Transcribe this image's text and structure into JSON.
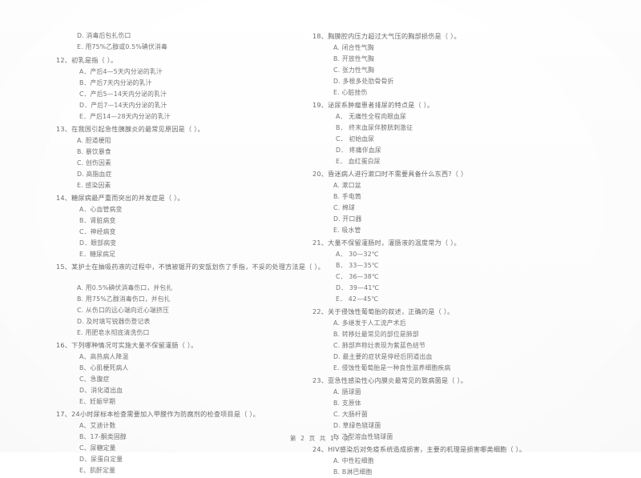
{
  "document": {
    "type": "exam-paper",
    "language": "zh-CN",
    "footer": "第 2 页  共 17 页"
  },
  "columns": {
    "left": {
      "orphan_options": [
        "D. 消毒后包扎伤口",
        "E. 用75%乙醇或0.5%碘伏消毒"
      ],
      "questions": [
        {
          "number": "12、",
          "stem": "初乳是指（     ）。",
          "options": [
            "A．产后4—5天内分泌的乳汁",
            "B．产后7天内分泌的乳汁",
            "C．产后5—14天内分泌的乳汁",
            "D．产后7—14天内分泌的乳汁",
            "E．产后14—28天内分泌的乳汁"
          ]
        },
        {
          "number": "13、",
          "stem": "在我国引起急性胰腺炎的最常见原因是（     ）。",
          "options": [
            "A. 胆道梗阻",
            "B. 暴饮暴食",
            "C. 创伤因素",
            "D. 高脂血症",
            "E. 感染因素"
          ]
        },
        {
          "number": "14、",
          "stem": "糖尿病最严重而突出的并发症是（     ）。",
          "options": [
            "A．心血管病变",
            "B．肾脏病变",
            "C．神经病变",
            "D．眼部病变",
            "E．糖尿病足"
          ]
        },
        {
          "number": "15、",
          "stem": "某护士在抽吸药液的过程中，不慎被锯开的安瓿划伤了手指，不妥的处理方法是（         ）。",
          "options": [
            "A. 用0.5%碘伏消毒伤口，并包扎",
            "B. 用75%乙醇消毒伤口，并包扎",
            "C. 从伤口的远心端向近心端挤压",
            "D. 及时填写锐器伤登记表",
            "E. 用肥皂水彻底清洗伤口"
          ]
        },
        {
          "number": "16、",
          "stem": "下列哪种情况可实施大量不保留灌肠（     ）。",
          "options": [
            "A、高热病人降温",
            "B、心肌梗死病人",
            "C、急腹症",
            "D、消化道出血",
            "E、妊娠早期"
          ]
        },
        {
          "number": "17、",
          "stem": "24小时尿标本检查需要加入甲醛作为防腐剂的检查项目是（     ）。",
          "options": [
            "A、艾迪计数",
            "B、17-酮类固醇",
            "C、尿糖定量",
            "D、尿蛋白定量",
            "E、肌酐定量"
          ]
        }
      ]
    },
    "right": {
      "questions": [
        {
          "number": "18、",
          "stem": "胸膜腔内压力超过大气压的胸部损伤是（     ）。",
          "options": [
            "A. 闭合性气胸",
            "B. 开放性气胸",
            "C. 张力性气胸",
            "D. 多根多处肋骨骨折",
            "E. 心脏挫伤"
          ]
        },
        {
          "number": "19、",
          "stem": "泌尿系肿瘤患者排尿的特点是（     ）。",
          "options": [
            "A． 无痛性全程肉眼血尿",
            "B． 终末血尿伴膀胱刺激征",
            "C． 初始血尿",
            "D． 疼痛伴血尿",
            "E． 血红蛋白尿"
          ]
        },
        {
          "number": "20、",
          "stem": "昏迷病人进行漱口时不需要具备什么东西?（     ）",
          "options": [
            "A. 漱口盆",
            "B. 手电筒",
            "C. 棉球",
            "D. 开口器",
            "E. 吸水管"
          ]
        },
        {
          "number": "21、",
          "stem": "大量不保留灌肠时，灌肠液的温度常为（     ）。",
          "options": [
            "A． 30—32℃",
            "B． 33—35℃",
            "C． 36—38℃",
            "D． 39—41℃",
            "E． 42—45℃"
          ]
        },
        {
          "number": "22、",
          "stem": "关于侵蚀性葡萄胎的叙述，正确的是（     ）。",
          "options": [
            "A. 多继发于人工流产术后",
            "B. 转移灶最常见的部位是肺部",
            "C. 肺部声称灶表现为紫蓝色结节",
            "D. 最主要的症状是停经后阴道出血",
            "E. 侵蚀性葡萄胎是一种良性滋养细胞疾病"
          ]
        },
        {
          "number": "23、",
          "stem": "亚急性感染性心内膜炎最常见的致病菌是（     ）。",
          "options": [
            "A. 肠球菌",
            "B. 支原体",
            "C. 大肠杆菌",
            "D. 草绿色链球菌",
            "E. 乙型溶血性链球菌"
          ]
        },
        {
          "number": "24、",
          "stem": "HIV感染后对免疫系统造成损害，主要的机理是损害哪类细胞（     ）。",
          "options": [
            "A. 中性粒细胞",
            "B. B淋巴细胞"
          ]
        }
      ]
    }
  }
}
